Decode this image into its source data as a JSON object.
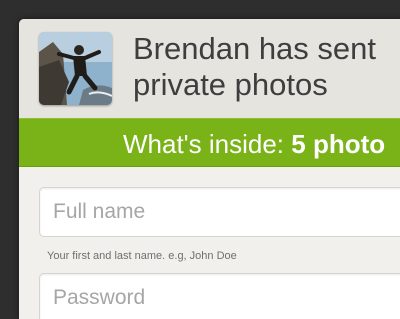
{
  "header": {
    "title_line1": "Brendan has sent",
    "title_line2": "private photos",
    "avatar_icon": "profile-photo"
  },
  "banner": {
    "prefix": "What's inside: ",
    "highlight": "5 photo"
  },
  "form": {
    "full_name_placeholder": "Full name",
    "full_name_hint": "Your first and last name. e.g, John Doe",
    "password_placeholder": "Password"
  },
  "colors": {
    "background": "#2e2e2e",
    "card": "#f1f0ec",
    "header": "#e6e4df",
    "banner": "#7ab317",
    "text": "#3e3e3e"
  }
}
